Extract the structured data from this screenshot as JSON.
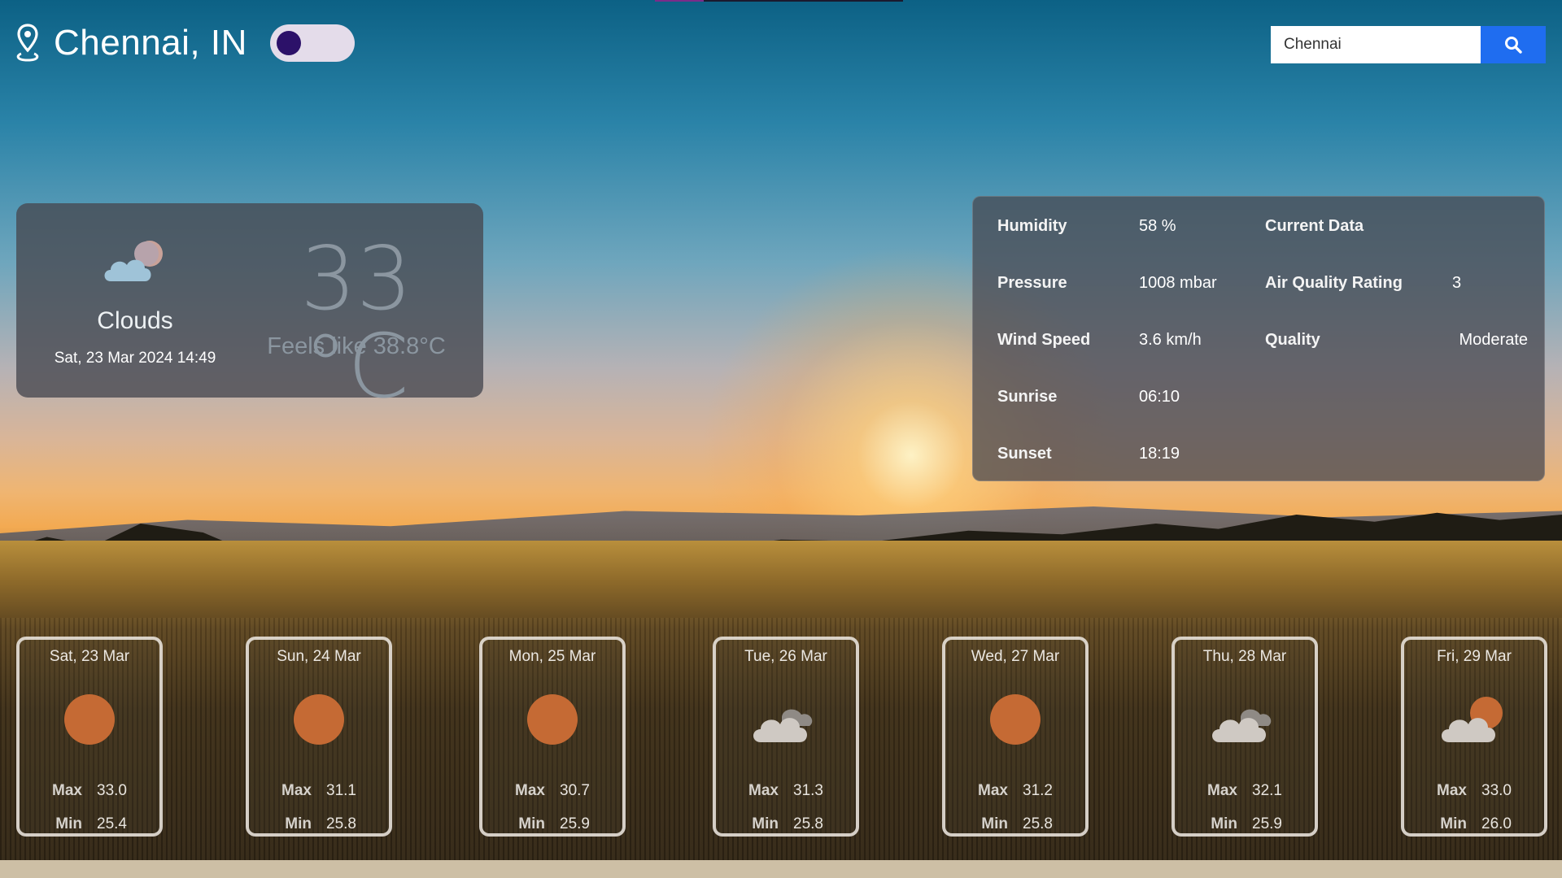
{
  "header": {
    "location": "Chennai, IN",
    "location_icon": "map-pin-icon",
    "theme_toggle_on": false
  },
  "search": {
    "value": "Chennai",
    "button_icon": "search-icon"
  },
  "current": {
    "icon": "clouds-icon",
    "condition": "Clouds",
    "datetime": "Sat, 23 Mar 2024 14:49",
    "temperature": "33 °C",
    "feels_like": "Feels like 38.8°C"
  },
  "details": {
    "humidity_label": "Humidity",
    "humidity_value": "58 %",
    "current_data_label": "Current Data",
    "pressure_label": "Pressure",
    "pressure_value": "1008 mbar",
    "aqr_label": "Air Quality Rating",
    "aqr_value": "3",
    "wind_label": "Wind Speed",
    "wind_value": "3.6 km/h",
    "quality_label": "Quality",
    "quality_value": "Moderate",
    "sunrise_label": "Sunrise",
    "sunrise_value": "06:10",
    "sunset_label": "Sunset",
    "sunset_value": "18:19"
  },
  "forecast_labels": {
    "max": "Max",
    "min": "Min"
  },
  "forecast": [
    {
      "date": "Sat, 23 Mar",
      "icon": "sun-icon",
      "max": "33.0",
      "min": "25.4"
    },
    {
      "date": "Sun, 24 Mar",
      "icon": "sun-icon",
      "max": "31.1",
      "min": "25.8"
    },
    {
      "date": "Mon, 25 Mar",
      "icon": "sun-icon",
      "max": "30.7",
      "min": "25.9"
    },
    {
      "date": "Tue, 26 Mar",
      "icon": "cloudy-icon",
      "max": "31.3",
      "min": "25.8"
    },
    {
      "date": "Wed, 27 Mar",
      "icon": "sun-icon",
      "max": "31.2",
      "min": "25.8"
    },
    {
      "date": "Thu, 28 Mar",
      "icon": "cloudy-icon",
      "max": "32.1",
      "min": "25.9"
    },
    {
      "date": "Fri, 29 Mar",
      "icon": "partly-cloudy-icon",
      "max": "33.0",
      "min": "26.0"
    }
  ],
  "colors": {
    "accent": "#1f6df0",
    "toggle_knob": "#2c1169",
    "card_bg": "#46484f",
    "sun": "#c56a34"
  }
}
